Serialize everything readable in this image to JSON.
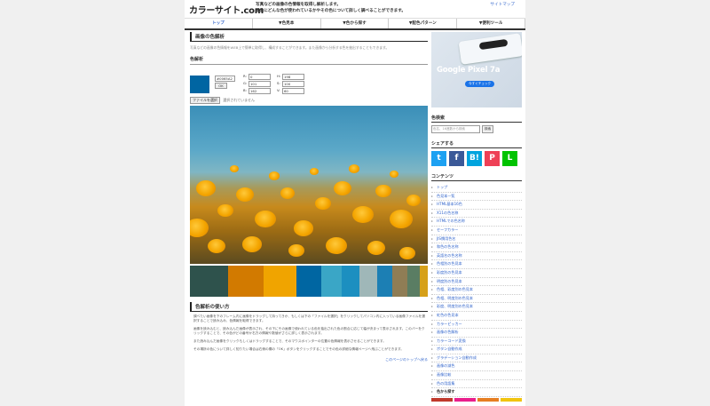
{
  "header": {
    "logo": "カラーサイト.com",
    "tagline_1": "写真などの画像の色情報を取得し解析します。",
    "tagline_2": "画像にどんな色が使われているかやその色について詳しく調べることができます。",
    "sitemap": "サイトマップ"
  },
  "nav": {
    "items": [
      "トップ",
      "▼色見本",
      "▼色から探す",
      "▼配色パターン",
      "▼便利ツール"
    ]
  },
  "main": {
    "title": "画像の色解析",
    "intro": "写真などの画像の色情報をWEB上で簡単に取得し、構成することができます。また画像から分析する色を抽出することもできます。",
    "analyze_heading": "色解析",
    "hex_value": "#0065A2",
    "ok_label": "OK",
    "r_label": "R:",
    "r_value": "0",
    "g_label": "G:",
    "g_value": "101",
    "b_label": "B:",
    "b_value": "162",
    "h_label": "H:",
    "h_value": "198",
    "s_label": "S:",
    "s_value": "100",
    "v_label": "V:",
    "v_value": "60",
    "file_button": "ファイルを選択",
    "file_status": "選択されていません",
    "usage_heading": "色解析の使い方",
    "usage_p1": "調べたい画像を下のフレーム内に画像をドラッグして持ってきか、もしくは下の「ファイルを選択」をクリックしてパソコン内に入っている画像ファイルを選択することで読み込み、色情報を取得できます。",
    "usage_p2": "画像を読み込むと、読み込んだ画像が表示され、その下にその画像で使われている色を抽出された色の割合に応じて幅が決まって表示されます。このバーをクリックすることで、その色がどの番号か右方の情報や数値がさらに詳しく表示されます。",
    "usage_p3": "また読み込んだ画像をクリックもしくはドラッグすることで、そのマウスポインターの位置の色情報を表示させることができます。",
    "usage_p4": "その場所の色について詳しく知りたい場合は右側の欄の「OK」ボタンをクリックすることでその色の詳細な情報ページへ飛ぶことができます。",
    "to_top": "このページのトップへ戻る"
  },
  "palette": {
    "colors": [
      "#2e524c",
      "#d27a00",
      "#f0a400",
      "#0066a2",
      "#3aa6c6",
      "#1c8fc0",
      "#9fb7b8",
      "#1c7fb4",
      "#8f7d55",
      "#5a7d63",
      "#d6a019"
    ],
    "weights": [
      15,
      14,
      13,
      10,
      8,
      7,
      7,
      6,
      6,
      5,
      3
    ]
  },
  "sidebar": {
    "ad_brand": "Google Pixel 7a",
    "ad_button": "今すぐチェック",
    "search_heading": "色検索",
    "search_placeholder": "色名、16進数から検索",
    "search_button": "検索",
    "share_heading": "シェアする",
    "share_buttons": [
      "t",
      "f",
      "B!",
      "P",
      "L"
    ],
    "share_colors": [
      "#1da1f2",
      "#3b5998",
      "#00a4de",
      "#ee4056",
      "#00c300"
    ],
    "contents_heading": "コンテンツ",
    "menu": [
      "トップ",
      "色見本一覧",
      "HTML基本16色",
      "X11の色名称",
      "HTMLでの色名称",
      "セーフカラー",
      "JIS慣用色名",
      "和色の色名称",
      "英語名の色名称",
      "色相別の色見本",
      "彩度別の色見本",
      "明度別の色見本",
      "色相、彩度別の色見本",
      "色相、明度別の色見本",
      "彩度、明度別の色見本",
      "虹色の色見本",
      "カラーピッカー",
      "画像の色解析",
      "カラーコード変換",
      "ボタン自動作成",
      "グラデーション自動作成",
      "画像の減色",
      "画像比較",
      "色の用語集",
      "色から探す"
    ],
    "chip_colors": [
      "#c0392b",
      "#e91e8c",
      "#e67e22",
      "#f1c40f"
    ]
  }
}
